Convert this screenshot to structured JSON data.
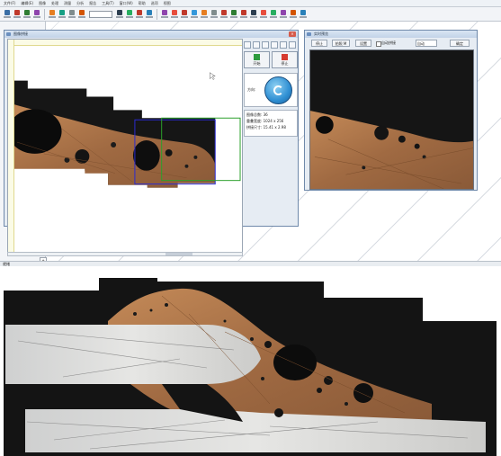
{
  "menu": [
    "文件(F)",
    "编辑(E)",
    "图像",
    "处理",
    "测量",
    "分析",
    "报告",
    "工具(T)",
    "窗口(W)",
    "帮助",
    "选项",
    "视图"
  ],
  "toolbar": {
    "zoom_value": "",
    "colors": [
      "#3a6ea5",
      "#c0392b",
      "#2e7d32",
      "#8e44ad",
      "#e67e22",
      "#16a085",
      "#7f8c8d",
      "#d35400",
      "#2c3e50",
      "#27ae60",
      "#c0392b",
      "#2980b9",
      "#8e44ad",
      "#e74c3c",
      "#c0392b",
      "#3498db",
      "#e67e22",
      "#7f8c8d",
      "#c0392b",
      "#2e7d32",
      "#c0392b",
      "#2c3e50",
      "#e74c3c",
      "#27ae60",
      "#8e44ad",
      "#d35400",
      "#2980b9"
    ]
  },
  "main_window": {
    "title": "图像拼接",
    "close_label": "×",
    "start_label": "开始",
    "stop_label": "停止",
    "direction_label": "方向:",
    "info_lines": [
      "图像总数: 36",
      "重叠宽度: 1024 x 256",
      "拼接尺寸: 15.41 x 2.98"
    ]
  },
  "preview_window": {
    "title": "实时预览",
    "buttons": [
      "停止",
      "拍照 M",
      "设置",
      "自动",
      "确定"
    ],
    "checkbox_label": "自动拼接"
  },
  "statusbar_text": "就绪",
  "colors": {
    "resin": "#141414",
    "copper": "#b07a50",
    "steel": "#d8d8d6",
    "accent": "#2f8fd3"
  }
}
